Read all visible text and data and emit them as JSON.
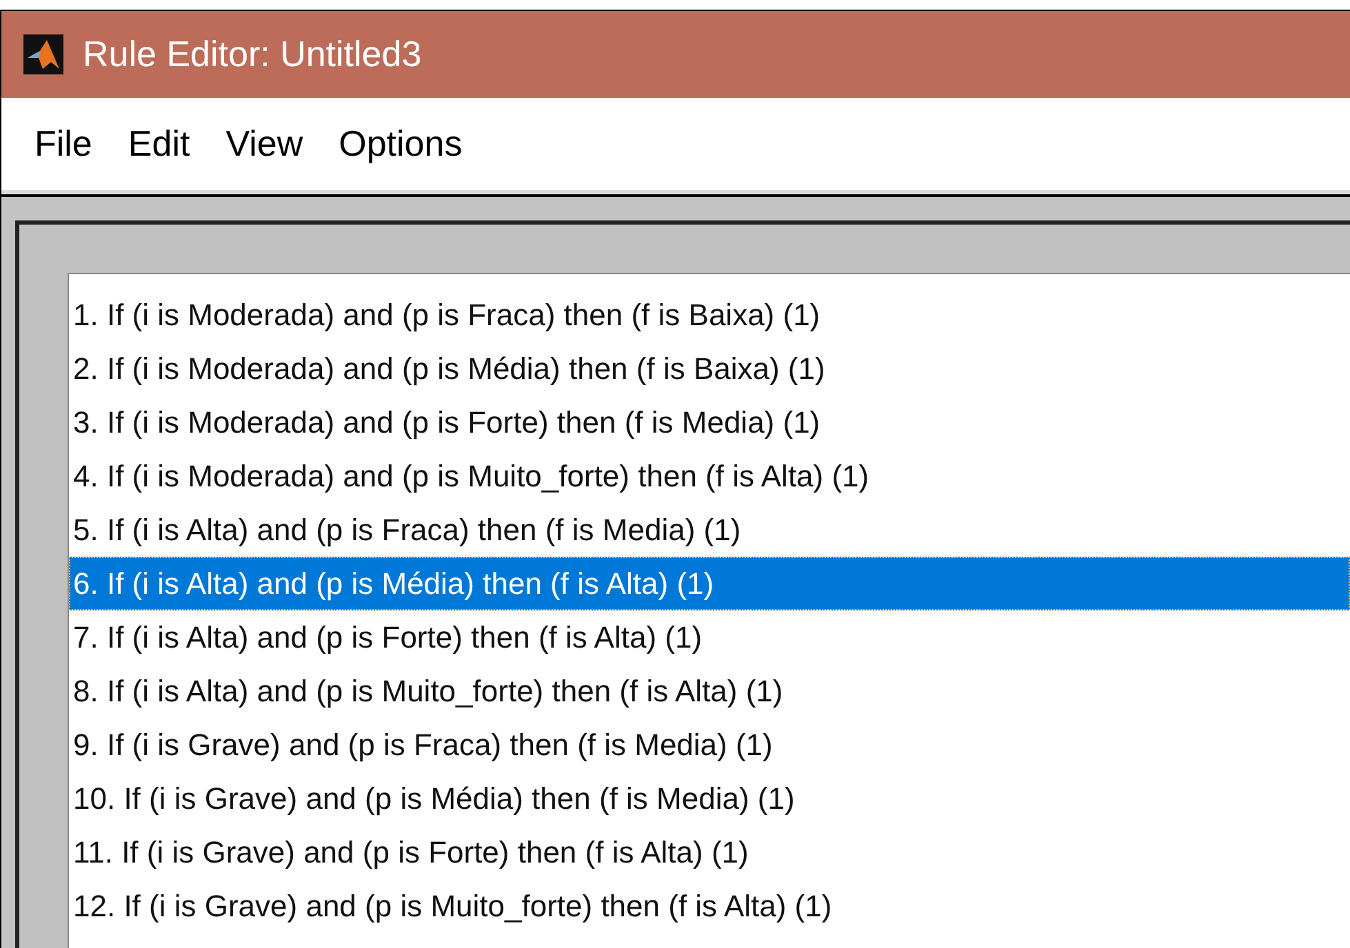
{
  "window": {
    "title": "Rule Editor: Untitled3"
  },
  "menu": [
    "File",
    "Edit",
    "View",
    "Options"
  ],
  "rules": [
    {
      "text": "1. If (i is Moderada) and (p is Fraca) then (f is Baixa) (1)",
      "selected": false
    },
    {
      "text": "2. If (i is Moderada) and (p is Média) then (f is Baixa) (1)",
      "selected": false
    },
    {
      "text": "3. If (i is Moderada) and (p is Forte) then (f is Media) (1)",
      "selected": false
    },
    {
      "text": "4. If (i is Moderada) and (p is Muito_forte) then (f is Alta) (1)",
      "selected": false
    },
    {
      "text": "5. If (i is Alta) and (p is Fraca) then (f is Media) (1)",
      "selected": false
    },
    {
      "text": "6. If (i is Alta) and (p is Média) then (f is Alta) (1)",
      "selected": true
    },
    {
      "text": "7. If (i is Alta) and (p is Forte) then (f is Alta) (1)",
      "selected": false
    },
    {
      "text": "8. If (i is Alta) and (p is Muito_forte) then (f is Alta) (1)",
      "selected": false
    },
    {
      "text": "9. If (i is Grave) and (p is Fraca) then (f is Media) (1)",
      "selected": false
    },
    {
      "text": "10. If (i is Grave) and (p is Média) then (f is Media) (1)",
      "selected": false
    },
    {
      "text": "11. If (i is Grave) and (p is Forte) then (f is Alta) (1)",
      "selected": false
    },
    {
      "text": "12. If (i is Grave) and (p is Muito_forte) then (f is Alta) (1)",
      "selected": false
    }
  ]
}
